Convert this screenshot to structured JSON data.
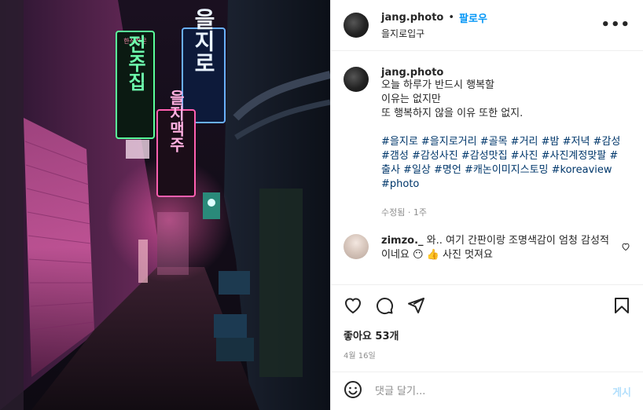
{
  "photo": {
    "signs": {
      "green": "한식전문",
      "green_main": "전주집",
      "blue": "을지로",
      "pink": "을지맥주"
    }
  },
  "header": {
    "username": "jang.photo",
    "dot": "•",
    "follow_label": "팔로우",
    "location": "을지로입구",
    "more": "•••"
  },
  "caption": {
    "username": "jang.photo",
    "lines": [
      "오늘 하루가 반드시 행복할",
      "이유는 없지만",
      "또 행복하지 않을 이유 또한 없지."
    ],
    "hashtags": "#을지로 #을지로거리 #골목 #거리 #밤 #저녁 #감성 #갬성 #감성사진 #감성맛집 #사진 #사진계정맞팔 #출사 #일상 #명언 #캐논이미지스토밍 #koreaview #photo",
    "meta": "수정됨 · 1주"
  },
  "comment": {
    "username": "zimzo._",
    "text": "와.. 여기 간판이랑 조명색감이 엄청 감성적이네요 😶 👍 사진 멋져요"
  },
  "actions": {
    "likes": "좋아요 53개",
    "date": "4월 16일"
  },
  "add_comment": {
    "placeholder": "댓글 달기...",
    "post_label": "게시"
  },
  "colors": {
    "accent": "#0095f6",
    "link": "#00376b",
    "muted": "#8e8e8e",
    "post_disabled": "#b2dffc"
  }
}
